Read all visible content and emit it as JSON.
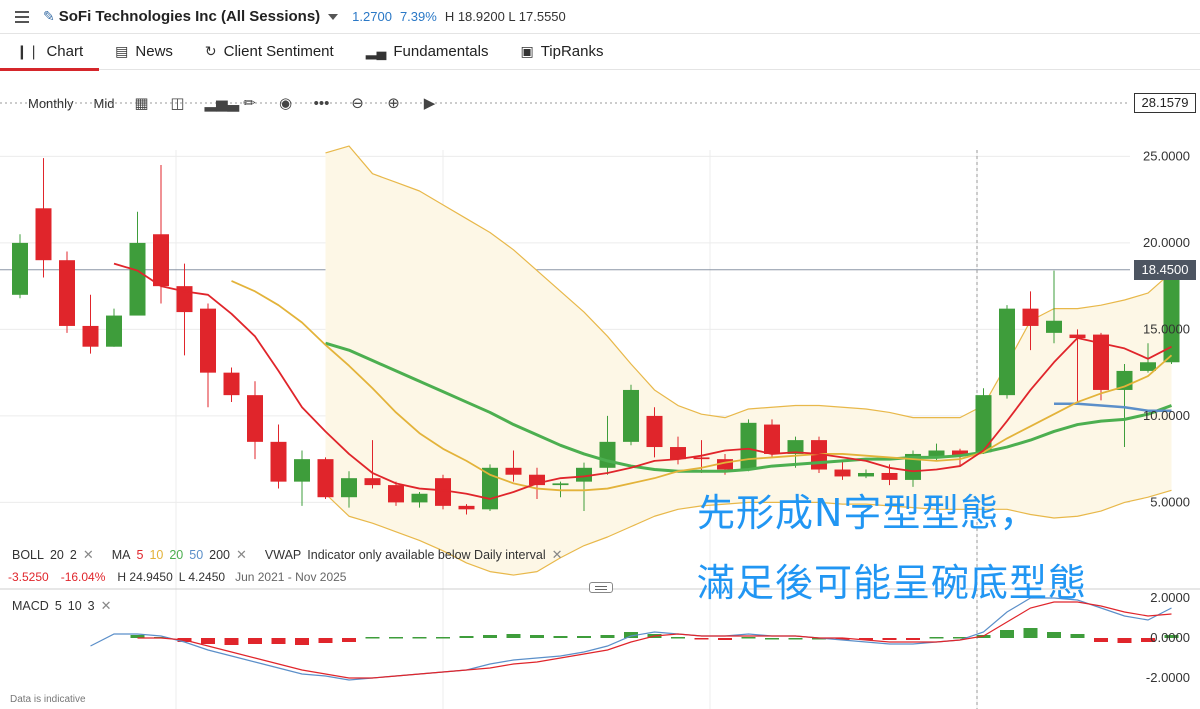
{
  "header": {
    "instrument": "SoFi Technologies Inc (All Sessions)",
    "change": "1.2700",
    "change_pct": "7.39%",
    "high_low": "H 18.9200  L 17.5550"
  },
  "tabs": [
    {
      "label": "Chart",
      "icon": "candles-icon",
      "active": true
    },
    {
      "label": "News",
      "icon": "newspaper-icon"
    },
    {
      "label": "Client Sentiment",
      "icon": "sentiment-icon"
    },
    {
      "label": "Fundamentals",
      "icon": "bar-chart-icon"
    },
    {
      "label": "TipRanks",
      "icon": "tipranks-icon"
    }
  ],
  "toolbar": {
    "interval": "Monthly",
    "price_type": "Mid"
  },
  "price_tags": {
    "crosshair": "28.1579",
    "last": "18.4500"
  },
  "legend": {
    "boll": {
      "label": "BOLL",
      "p1": "20",
      "p2": "2"
    },
    "ma": {
      "label": "MA",
      "p1": "5",
      "p2": "10",
      "p3": "20",
      "p4": "50",
      "p5": "200"
    },
    "vwap": {
      "label": "VWAP",
      "note": "Indicator only available below Daily interval"
    },
    "stats": {
      "change": "-3.5250",
      "pct": "-16.04%",
      "high": "H 24.9450",
      "low": "L 4.2450",
      "range": "Jun 2021 - Nov 2025"
    },
    "macd": {
      "label": "MACD",
      "p1": "5",
      "p2": "10",
      "p3": "3"
    }
  },
  "annotation": {
    "line1": "先形成N字型型態，",
    "line2": "滿足後可能呈碗底型態"
  },
  "footer": "Data is indicative",
  "colors": {
    "up": "#3e9d3b",
    "down": "#e0252b",
    "ma5": "#e0252b",
    "ma10": "#e3b33a",
    "ma20": "#4caf50",
    "ma50": "#5b8fc9",
    "boll_band": "#e8b84a",
    "boll_fill": "#fdf7e6",
    "annotation": "#2196f3",
    "tab_active": "#d5262b"
  },
  "chart_data": {
    "type": "candlestick",
    "price_axis": {
      "ticks": [
        "25.0000",
        "20.0000",
        "15.0000",
        "10.0000",
        "5.0000"
      ],
      "tick_values": [
        25,
        20,
        15,
        10,
        5
      ]
    },
    "macd_axis": {
      "ticks": [
        "2.0000",
        "0.0000",
        "-2.0000"
      ],
      "tick_values": [
        2,
        0,
        -2
      ]
    },
    "candles": [
      {
        "o": 17.0,
        "h": 20.5,
        "l": 16.8,
        "c": 20.0
      },
      {
        "o": 22.0,
        "h": 24.9,
        "l": 18.0,
        "c": 19.0
      },
      {
        "o": 19.0,
        "h": 19.5,
        "l": 14.8,
        "c": 15.2
      },
      {
        "o": 15.2,
        "h": 17.0,
        "l": 13.6,
        "c": 14.0
      },
      {
        "o": 14.0,
        "h": 16.2,
        "l": 14.0,
        "c": 15.8
      },
      {
        "o": 15.8,
        "h": 21.8,
        "l": 15.8,
        "c": 20.0
      },
      {
        "o": 20.5,
        "h": 24.5,
        "l": 16.5,
        "c": 17.5
      },
      {
        "o": 17.5,
        "h": 18.8,
        "l": 13.5,
        "c": 16.0
      },
      {
        "o": 16.2,
        "h": 16.5,
        "l": 10.5,
        "c": 12.5
      },
      {
        "o": 12.5,
        "h": 12.8,
        "l": 10.8,
        "c": 11.2
      },
      {
        "o": 11.2,
        "h": 12.0,
        "l": 7.5,
        "c": 8.5
      },
      {
        "o": 8.5,
        "h": 9.5,
        "l": 5.8,
        "c": 6.2
      },
      {
        "o": 6.2,
        "h": 8.0,
        "l": 4.8,
        "c": 7.5
      },
      {
        "o": 7.5,
        "h": 7.6,
        "l": 5.2,
        "c": 5.3
      },
      {
        "o": 5.3,
        "h": 6.8,
        "l": 4.7,
        "c": 6.4
      },
      {
        "o": 6.4,
        "h": 8.6,
        "l": 5.8,
        "c": 6.0
      },
      {
        "o": 6.0,
        "h": 6.2,
        "l": 4.8,
        "c": 5.0
      },
      {
        "o": 5.0,
        "h": 5.6,
        "l": 4.7,
        "c": 5.5
      },
      {
        "o": 6.4,
        "h": 6.6,
        "l": 4.6,
        "c": 4.8
      },
      {
        "o": 4.8,
        "h": 4.9,
        "l": 4.3,
        "c": 4.6
      },
      {
        "o": 4.6,
        "h": 7.2,
        "l": 4.5,
        "c": 7.0
      },
      {
        "o": 7.0,
        "h": 8.0,
        "l": 6.2,
        "c": 6.6
      },
      {
        "o": 6.6,
        "h": 7.0,
        "l": 5.2,
        "c": 6.0
      },
      {
        "o": 6.0,
        "h": 6.2,
        "l": 5.3,
        "c": 6.1
      },
      {
        "o": 6.2,
        "h": 7.3,
        "l": 4.5,
        "c": 7.0
      },
      {
        "o": 7.0,
        "h": 10.0,
        "l": 6.6,
        "c": 8.5
      },
      {
        "o": 8.5,
        "h": 11.8,
        "l": 8.3,
        "c": 11.5
      },
      {
        "o": 10.0,
        "h": 10.5,
        "l": 7.6,
        "c": 8.2
      },
      {
        "o": 8.2,
        "h": 8.8,
        "l": 7.2,
        "c": 7.5
      },
      {
        "o": 7.6,
        "h": 8.6,
        "l": 6.7,
        "c": 7.5
      },
      {
        "o": 7.5,
        "h": 7.8,
        "l": 6.6,
        "c": 6.9
      },
      {
        "o": 6.9,
        "h": 9.8,
        "l": 6.8,
        "c": 9.6
      },
      {
        "o": 9.5,
        "h": 9.8,
        "l": 7.6,
        "c": 7.8
      },
      {
        "o": 7.8,
        "h": 8.8,
        "l": 7.0,
        "c": 8.6
      },
      {
        "o": 8.6,
        "h": 8.8,
        "l": 6.7,
        "c": 6.9
      },
      {
        "o": 6.9,
        "h": 7.4,
        "l": 6.3,
        "c": 6.5
      },
      {
        "o": 6.5,
        "h": 6.9,
        "l": 6.4,
        "c": 6.7
      },
      {
        "o": 6.7,
        "h": 7.2,
        "l": 6.0,
        "c": 6.3
      },
      {
        "o": 6.3,
        "h": 8.0,
        "l": 5.9,
        "c": 7.8
      },
      {
        "o": 7.6,
        "h": 8.4,
        "l": 7.4,
        "c": 8.0
      },
      {
        "o": 8.0,
        "h": 8.1,
        "l": 7.1,
        "c": 7.7
      },
      {
        "o": 7.9,
        "h": 11.6,
        "l": 7.8,
        "c": 11.2
      },
      {
        "o": 11.2,
        "h": 16.4,
        "l": 11.0,
        "c": 16.2
      },
      {
        "o": 16.2,
        "h": 17.2,
        "l": 13.8,
        "c": 15.2
      },
      {
        "o": 14.8,
        "h": 18.4,
        "l": 14.2,
        "c": 15.5
      },
      {
        "o": 14.7,
        "h": 15.0,
        "l": 10.8,
        "c": 14.5
      },
      {
        "o": 14.7,
        "h": 14.8,
        "l": 10.9,
        "c": 11.5
      },
      {
        "o": 11.5,
        "h": 13.0,
        "l": 8.2,
        "c": 12.6
      },
      {
        "o": 12.6,
        "h": 14.2,
        "l": 12.5,
        "c": 13.1
      },
      {
        "o": 13.1,
        "h": 18.9,
        "l": 13.0,
        "c": 18.45
      }
    ],
    "ma5": [
      null,
      null,
      null,
      null,
      18.8,
      18.4,
      17.5,
      17.2,
      17.0,
      15.9,
      14.6,
      12.6,
      10.5,
      9.1,
      7.8,
      6.7,
      6.1,
      5.8,
      5.7,
      5.5,
      5.2,
      5.6,
      6.1,
      6.4,
      6.5,
      6.7,
      7.0,
      7.4,
      7.5,
      7.7,
      8.0,
      8.1,
      7.8,
      7.9,
      7.8,
      7.6,
      7.4,
      7.0,
      6.8,
      6.9,
      7.1,
      8.0,
      9.7,
      11.5,
      13.1,
      14.5,
      14.2,
      13.9,
      13.3,
      14.0
    ],
    "ma10": [
      null,
      null,
      null,
      null,
      null,
      null,
      null,
      null,
      null,
      17.8,
      17.2,
      16.4,
      15.4,
      14.1,
      12.9,
      11.6,
      10.2,
      9.0,
      8.1,
      7.4,
      6.6,
      6.1,
      5.8,
      5.7,
      5.7,
      5.8,
      6.1,
      6.4,
      6.8,
      7.0,
      7.3,
      7.5,
      7.6,
      7.7,
      7.8,
      7.8,
      7.7,
      7.6,
      7.5,
      7.4,
      7.5,
      7.9,
      8.7,
      9.4,
      10.1,
      10.8,
      11.3,
      11.7,
      12.3,
      13.5
    ],
    "ma20": [
      null,
      null,
      null,
      null,
      null,
      null,
      null,
      null,
      null,
      null,
      null,
      null,
      null,
      14.2,
      13.8,
      13.2,
      12.6,
      12.0,
      11.4,
      10.8,
      10.2,
      9.5,
      8.9,
      8.3,
      7.8,
      7.4,
      7.1,
      6.9,
      6.8,
      6.8,
      6.8,
      6.9,
      7.1,
      7.2,
      7.3,
      7.4,
      7.5,
      7.5,
      7.6,
      7.6,
      7.7,
      7.9,
      8.2,
      8.6,
      9.1,
      9.5,
      9.7,
      9.8,
      10.1,
      10.6
    ],
    "ma50": [
      null,
      null,
      null,
      null,
      null,
      null,
      null,
      null,
      null,
      null,
      null,
      null,
      null,
      null,
      null,
      null,
      null,
      null,
      null,
      null,
      null,
      null,
      null,
      null,
      null,
      null,
      null,
      null,
      null,
      null,
      null,
      null,
      null,
      null,
      null,
      null,
      null,
      null,
      null,
      null,
      null,
      null,
      null,
      null,
      10.7,
      10.7,
      10.6,
      10.5,
      10.3,
      10.3
    ],
    "boll_upper": [
      null,
      null,
      null,
      null,
      null,
      null,
      null,
      null,
      null,
      null,
      null,
      null,
      null,
      25.2,
      25.6,
      24.0,
      23.5,
      23.0,
      22.2,
      21.4,
      20.6,
      19.6,
      18.4,
      17.2,
      16.0,
      14.6,
      13.0,
      11.5,
      10.6,
      10.1,
      9.9,
      10.4,
      10.5,
      10.6,
      10.6,
      10.5,
      10.4,
      10.2,
      9.9,
      9.9,
      9.9,
      10.6,
      13.0,
      15.5,
      16.2,
      16.2,
      16.4,
      16.7,
      17.1,
      18.3
    ],
    "boll_lower": [
      null,
      null,
      null,
      null,
      null,
      null,
      null,
      null,
      null,
      null,
      null,
      null,
      null,
      5.5,
      4.2,
      3.8,
      3.3,
      2.8,
      2.2,
      1.5,
      1.0,
      0.8,
      1.0,
      1.8,
      2.5,
      3.0,
      3.6,
      4.2,
      4.6,
      4.8,
      4.9,
      5.0,
      5.0,
      5.0,
      5.0,
      4.9,
      4.9,
      4.8,
      4.7,
      4.6,
      4.6,
      4.6,
      4.6,
      4.3,
      4.1,
      4.2,
      4.5,
      5.0,
      5.3,
      5.7
    ],
    "macd_line": [
      null,
      null,
      null,
      -0.4,
      0.2,
      0.2,
      0.1,
      -0.2,
      -0.6,
      -0.9,
      -1.2,
      -1.5,
      -1.8,
      -1.9,
      -2.1,
      -2.0,
      -1.9,
      -1.8,
      -1.7,
      -1.6,
      -1.3,
      -1.1,
      -1.0,
      -0.9,
      -0.7,
      -0.4,
      0.1,
      0.3,
      0.2,
      0.1,
      0.1,
      0.2,
      0.1,
      0.1,
      0.0,
      -0.1,
      -0.2,
      -0.3,
      -0.3,
      -0.2,
      -0.1,
      0.3,
      1.3,
      2.0,
      2.0,
      1.9,
      1.5,
      1.1,
      0.9,
      1.5
    ],
    "macd_signal": [
      null,
      null,
      null,
      null,
      null,
      0.0,
      0.0,
      -0.1,
      -0.4,
      -0.7,
      -1.0,
      -1.3,
      -1.6,
      -1.8,
      -2.0,
      -2.0,
      -1.9,
      -1.8,
      -1.7,
      -1.6,
      -1.5,
      -1.3,
      -1.2,
      -1.0,
      -0.8,
      -0.6,
      -0.2,
      0.1,
      0.2,
      0.1,
      0.1,
      0.1,
      0.1,
      0.1,
      0.0,
      0.0,
      -0.1,
      -0.2,
      -0.2,
      -0.2,
      -0.1,
      0.1,
      0.8,
      1.5,
      1.8,
      1.8,
      1.6,
      1.3,
      1.1,
      1.2
    ],
    "macd_hist": [
      null,
      null,
      null,
      null,
      null,
      0.15,
      0.05,
      -0.2,
      -0.3,
      -0.35,
      -0.3,
      -0.3,
      -0.35,
      -0.25,
      -0.2,
      0.05,
      0.05,
      0.05,
      0.05,
      0.1,
      0.15,
      0.2,
      0.15,
      0.1,
      0.1,
      0.15,
      0.3,
      0.2,
      0.05,
      -0.05,
      -0.1,
      0.05,
      0.0,
      0.0,
      0.0,
      -0.1,
      -0.1,
      -0.1,
      -0.1,
      0.05,
      0.05,
      0.15,
      0.4,
      0.5,
      0.3,
      0.2,
      -0.2,
      -0.25,
      -0.2,
      0.15
    ]
  }
}
